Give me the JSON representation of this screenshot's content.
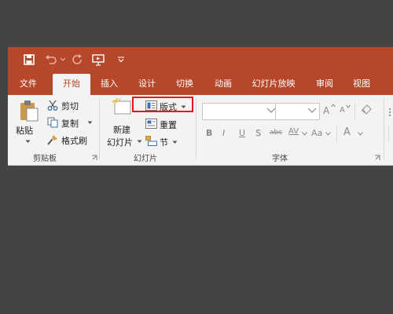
{
  "tabs": [
    {
      "label": "文件"
    },
    {
      "label": "开始"
    },
    {
      "label": "插入"
    },
    {
      "label": "设计"
    },
    {
      "label": "切换"
    },
    {
      "label": "动画"
    },
    {
      "label": "幻灯片放映"
    },
    {
      "label": "审阅"
    },
    {
      "label": "视图"
    }
  ],
  "clipboard": {
    "paste": "粘贴",
    "cut": "剪切",
    "copy": "复制",
    "format_painter": "格式刷",
    "group": "剪贴板"
  },
  "slides": {
    "new_slide_line1": "新建",
    "new_slide_line2": "幻灯片",
    "layout": "版式",
    "reset": "重置",
    "section": "节",
    "group": "幻灯片"
  },
  "font": {
    "bold": "B",
    "italic": "I",
    "underline": "U",
    "shadow": "S",
    "strike": "abc",
    "spacing": "AV",
    "case": "Aa",
    "color": "A",
    "grow": "A",
    "shrink": "A",
    "group": "字体"
  },
  "colors": {
    "accent": "#b7472a",
    "ribbon": "#f3f3f3",
    "highlight": "#e8141c"
  }
}
